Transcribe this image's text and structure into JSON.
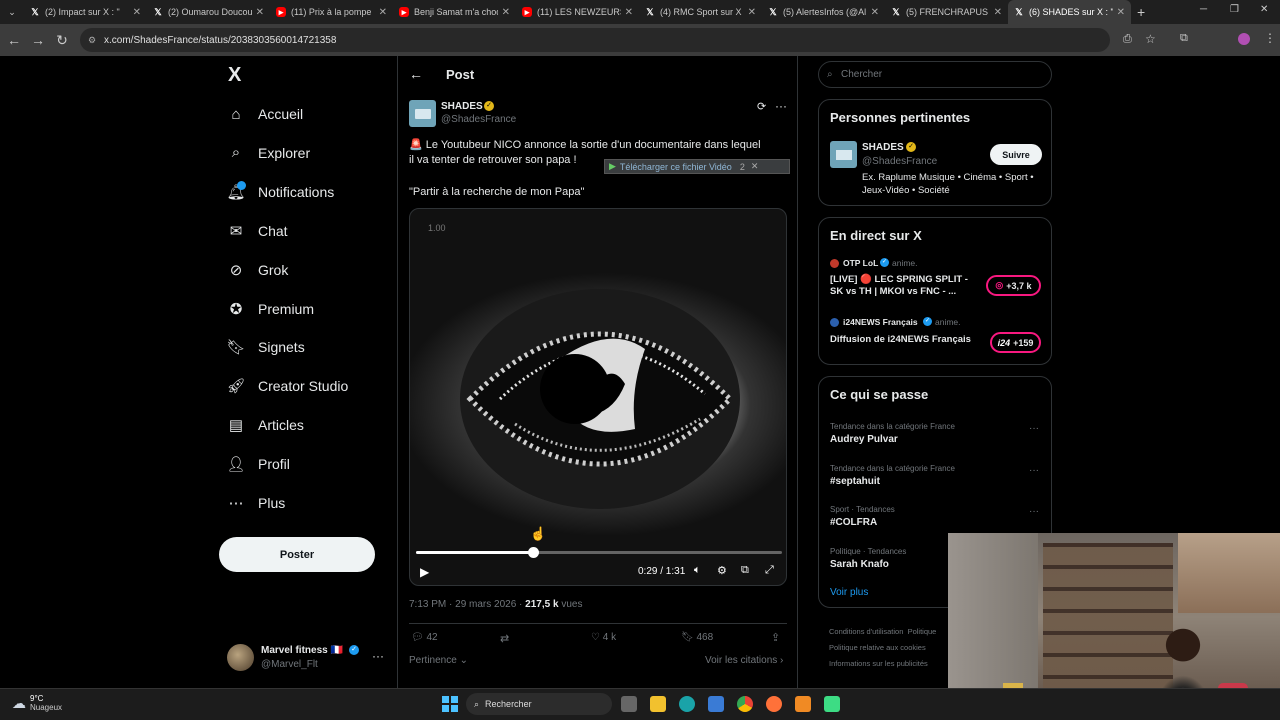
{
  "browser": {
    "tabs": [
      {
        "label": "(2) Impact sur X : \"",
        "icon": "x"
      },
      {
        "label": "(2) Oumarou Doucou",
        "icon": "x"
      },
      {
        "label": "(11) Prix à la pompe",
        "icon": "yt"
      },
      {
        "label": "Benji Samat m'a choq",
        "icon": "yt"
      },
      {
        "label": "(11) LES NEWZEURS",
        "icon": "yt"
      },
      {
        "label": "(4) RMC Sport sur X",
        "icon": "x"
      },
      {
        "label": "(5) AlertesInfos (@Al",
        "icon": "x"
      },
      {
        "label": "(5) FRENCHRAPUS su",
        "icon": "x"
      },
      {
        "label": "(6) SHADES sur X : \"",
        "icon": "x",
        "active": true
      }
    ],
    "url": "x.com/ShadesFrance/status/2038303560014721358",
    "new_tab": "+"
  },
  "sidebar": {
    "logo": "X",
    "items": [
      {
        "label": "Accueil",
        "icon": "home-icon"
      },
      {
        "label": "Explorer",
        "icon": "search-icon"
      },
      {
        "label": "Notifications",
        "icon": "bell-icon"
      },
      {
        "label": "Chat",
        "icon": "mail-icon"
      },
      {
        "label": "Grok",
        "icon": "grok-icon"
      },
      {
        "label": "Premium",
        "icon": "premium-icon"
      },
      {
        "label": "Signets",
        "icon": "bookmark-icon"
      },
      {
        "label": "Creator Studio",
        "icon": "rocket-icon"
      },
      {
        "label": "Articles",
        "icon": "article-icon"
      },
      {
        "label": "Profil",
        "icon": "person-icon"
      },
      {
        "label": "Plus",
        "icon": "more-circle-icon"
      }
    ],
    "post_button": "Poster",
    "account": {
      "name": "Marvel fitness 🇫🇷",
      "handle": "@Marvel_Flt"
    }
  },
  "post": {
    "header": "Post",
    "author_name": "SHADES",
    "author_handle": "@ShadesFrance",
    "text_line1": "🚨 Le Youtubeur NICO annonce la sortie d'un documentaire dans lequel",
    "text_line2": "il va tenter de retrouver son papa !",
    "quote": "\"Partir à la recherche de mon Papa\"",
    "download_overlay": "Télécharger ce fichier Vidéo",
    "download_count": "2",
    "video": {
      "speed": "1.00",
      "time": "0:29 / 1:31",
      "progress": 0.32
    },
    "meta_time": "7:13 PM · 29 mars 2026 · ",
    "views_count": "217,5 k",
    "views_label": " vues",
    "actions": {
      "replies": "42",
      "reposts": "",
      "likes": "4 k",
      "bookmarks": "468"
    },
    "sort_label": "Pertinence",
    "quotes_link": "Voir les citations"
  },
  "right": {
    "search_placeholder": "Chercher",
    "relevant_title": "Personnes pertinentes",
    "relevant": {
      "name": "SHADES",
      "handle": "@ShadesFrance",
      "bio": "Ex. Raplume Musique • Cinéma • Sport • Jeux-Vidéo • Société",
      "follow": "Suivre"
    },
    "live_title": "En direct sur X",
    "live": [
      {
        "host": "OTP LoL",
        "tag": "anime.",
        "title": "[LIVE] 🔴 LEC SPRING SPLIT - SK vs TH | MKOI vs FNC - ...",
        "count": "+3,7 k"
      },
      {
        "host": "i24NEWS Français",
        "tag": "anime.",
        "title": "Diffusion de i24NEWS Français",
        "count": "+159",
        "badge": "i24"
      }
    ],
    "trends_title": "Ce qui se passe",
    "trends": [
      {
        "context": "Tendance dans la catégorie France",
        "name": "Audrey Pulvar"
      },
      {
        "context": "Tendance dans la catégorie France",
        "name": "#septahuit"
      },
      {
        "context": "Sport · Tendances",
        "name": "#COLFRA"
      },
      {
        "context": "Politique · Tendances",
        "name": "Sarah Knafo"
      }
    ],
    "see_more": "Voir plus",
    "footer": [
      "Conditions d'utilisation",
      "Politique",
      "Politique relative aux cookies",
      "Informations sur les publicités"
    ]
  },
  "taskbar": {
    "temp": "9°C",
    "weather": "Nuageux",
    "search": "Rechercher"
  }
}
